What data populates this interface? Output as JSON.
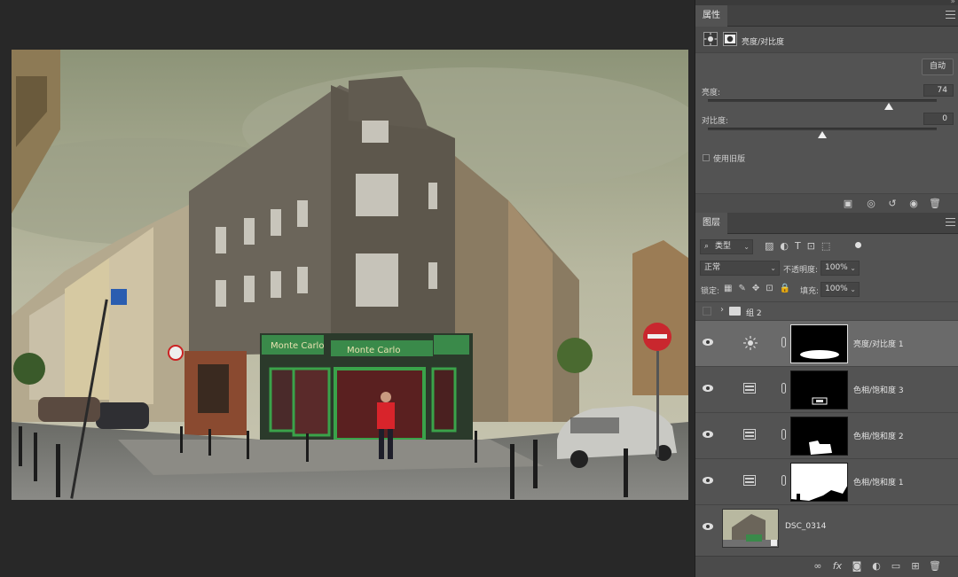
{
  "properties": {
    "tab": "属性",
    "title": "亮度/对比度",
    "auto_button": "自动",
    "brightness_label": "亮度:",
    "brightness_value": "74",
    "brightness_pct": 0.79,
    "contrast_label": "对比度:",
    "contrast_value": "0",
    "contrast_pct": 0.5,
    "legacy_label": "使用旧版"
  },
  "layers": {
    "tab": "图层",
    "filter": "类型",
    "blend_mode": "正常",
    "opacity_label": "不透明度:",
    "opacity_value": "100%",
    "lock_label": "锁定:",
    "fill_label": "填充:",
    "fill_value": "100%",
    "group_name": "组 2",
    "items": [
      {
        "name": "亮度/对比度 1",
        "type": "brightness",
        "selected": true
      },
      {
        "name": "色相/饱和度 3",
        "type": "hue"
      },
      {
        "name": "色相/饱和度 2",
        "type": "hue"
      },
      {
        "name": "色相/饱和度 1",
        "type": "hue"
      },
      {
        "name": "DSC_0314",
        "type": "image"
      }
    ]
  },
  "photo": {
    "signs": [
      "Monte Carlo",
      "Monte Carlo"
    ]
  }
}
